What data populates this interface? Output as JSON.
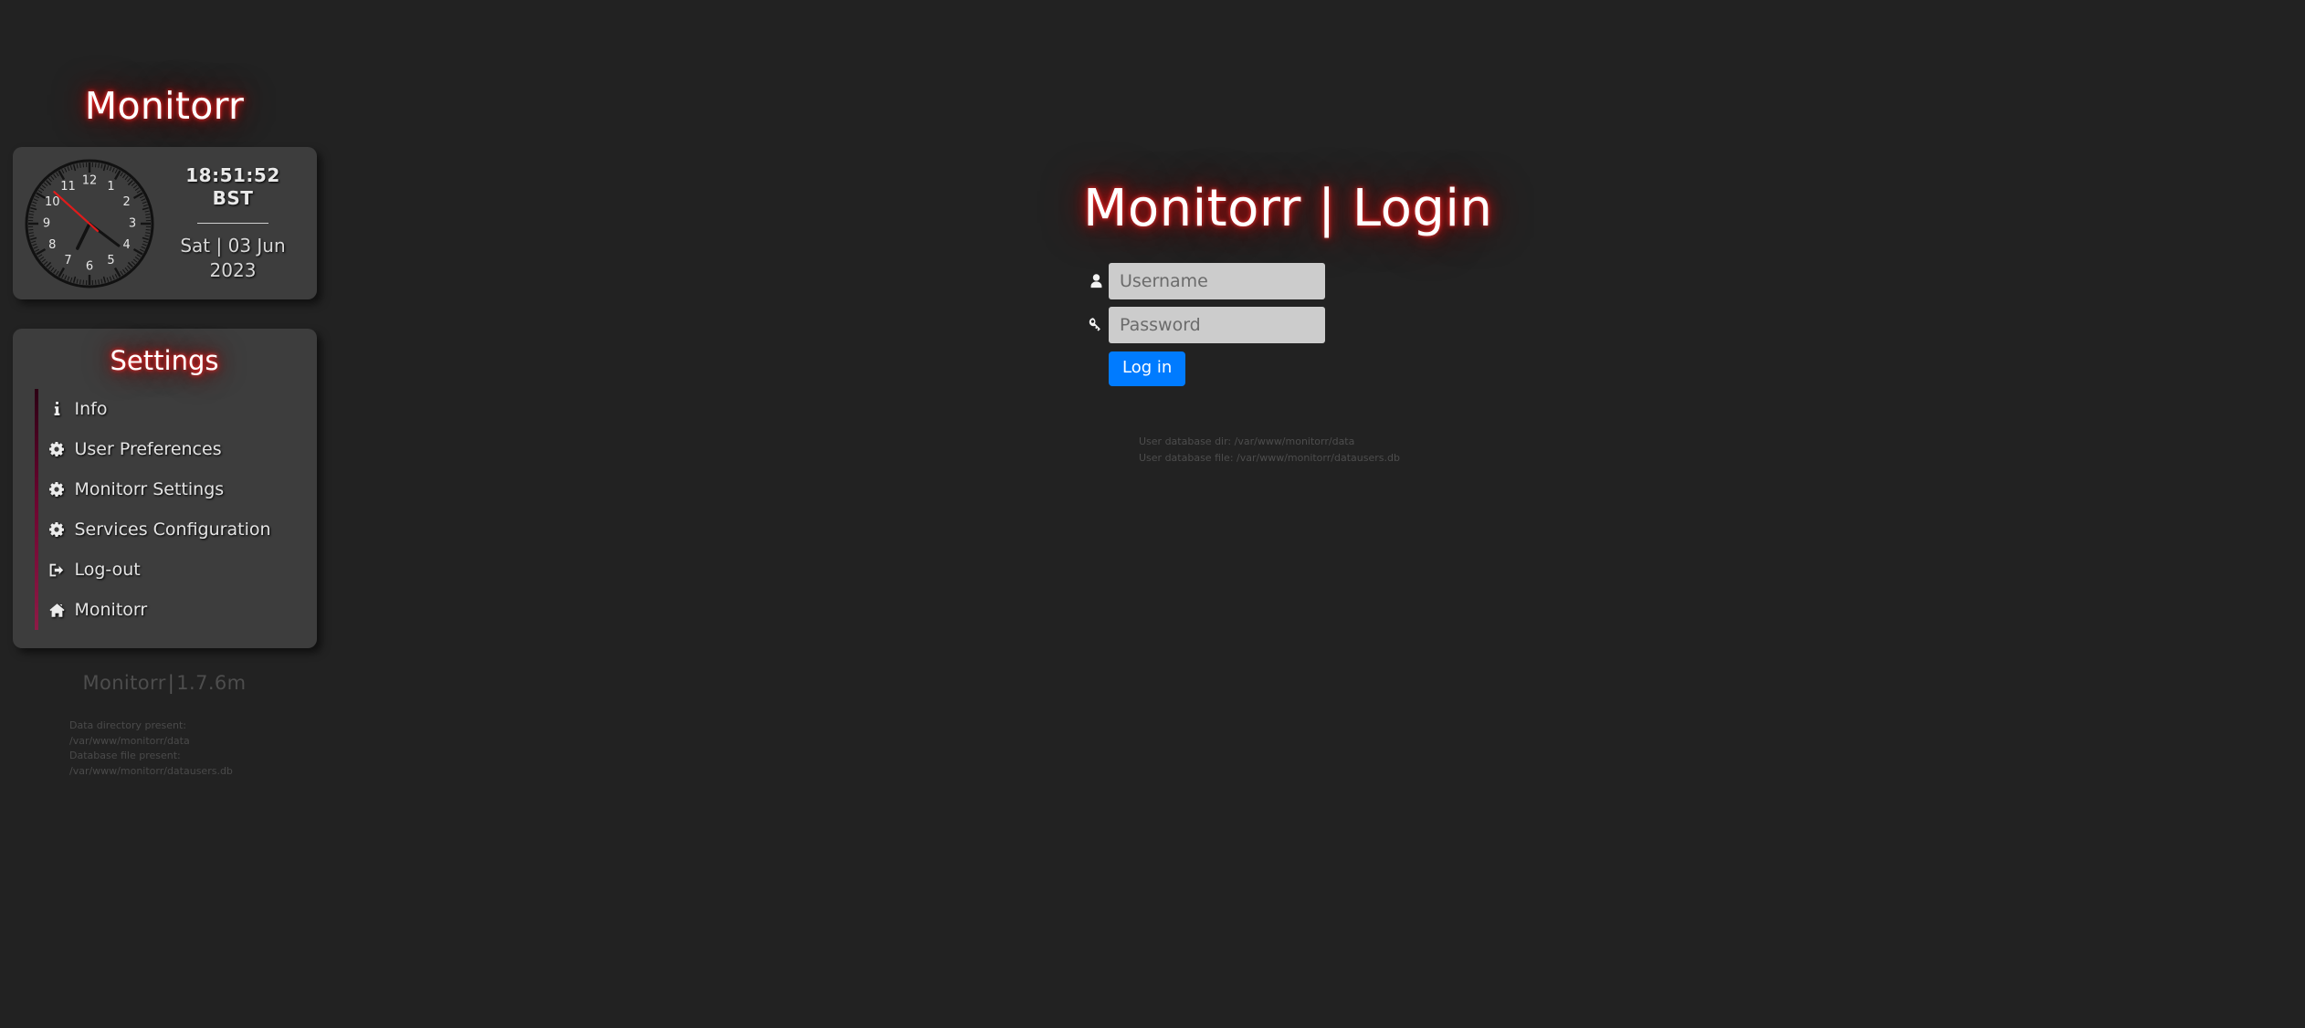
{
  "page": {
    "background_color": "#222222",
    "panel_color": "#3d3d3d",
    "accent_color": "#8d1b46",
    "glow_color": "#cc1111",
    "button_color": "#007bff"
  },
  "brand": {
    "title": "Monitorr"
  },
  "clock": {
    "time": "18:51:52",
    "timezone": "BST",
    "date_line1": "Sat | 03 Jun",
    "date_line2": "2023",
    "hour_hand_angle_deg": 206,
    "minute_hand_angle_deg": 127,
    "second_hand_angle_deg": 312,
    "numerals": [
      "1",
      "2",
      "3",
      "4",
      "5",
      "6",
      "7",
      "8",
      "9",
      "10",
      "11",
      "12"
    ]
  },
  "settings": {
    "title": "Settings",
    "items": [
      {
        "label": "Info",
        "icon": "info-icon"
      },
      {
        "label": "User Preferences",
        "icon": "gear-icon"
      },
      {
        "label": "Monitorr Settings",
        "icon": "gear-icon"
      },
      {
        "label": "Services Configuration",
        "icon": "gear-icon"
      },
      {
        "label": "Log-out",
        "icon": "logout-icon"
      },
      {
        "label": "Monitorr",
        "icon": "home-icon"
      }
    ]
  },
  "footer": {
    "app_name": "Monitorr",
    "separator": "|",
    "version": "1.7.6m",
    "status_lines": [
      "Data directory present:",
      "/var/www/monitorr/data",
      "Database file present:",
      "/var/www/monitorr/datausers.db"
    ]
  },
  "login": {
    "title": "Monitorr | Login",
    "username": {
      "placeholder": "Username",
      "value": "",
      "icon": "user-icon"
    },
    "password": {
      "placeholder": "Password",
      "value": "",
      "icon": "key-icon"
    },
    "submit_label": "Log in",
    "db_info_lines": [
      "User database dir: /var/www/monitorr/data",
      "User database file: /var/www/monitorr/datausers.db"
    ]
  }
}
